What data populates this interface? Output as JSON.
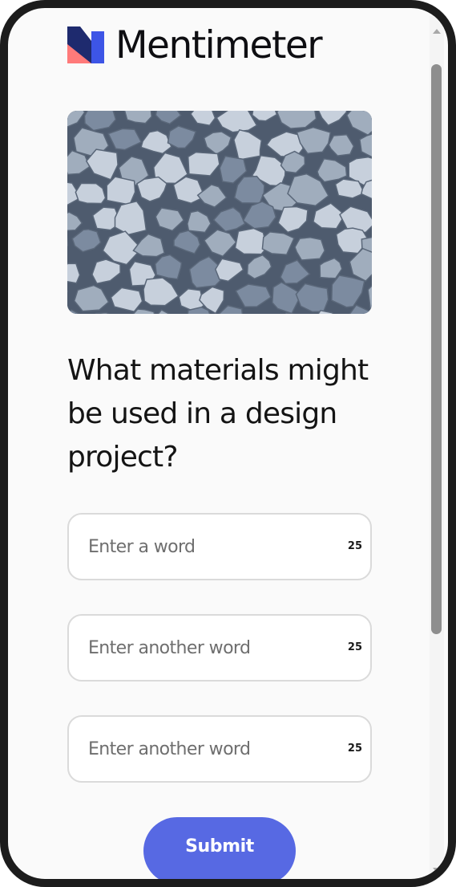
{
  "brand": {
    "name": "Mentimeter",
    "colors": {
      "navy": "#1e2a6e",
      "blue": "#3d55e6",
      "coral": "#ff7a7a"
    }
  },
  "hero_image": {
    "subject": "pile of grey gravel stones",
    "colors": {
      "base": "#4e5b6e",
      "stone_light": "#c7d0dc",
      "stone_mid": "#a0adbd",
      "stone_dark": "#7c8ba0"
    }
  },
  "question": {
    "text": "What materials might be used in a design project?"
  },
  "fields": [
    {
      "placeholder": "Enter a word",
      "limit": "25"
    },
    {
      "placeholder": "Enter another word",
      "limit": "25"
    },
    {
      "placeholder": "Enter another word",
      "limit": "25"
    }
  ],
  "submit": {
    "label": "Submit",
    "color": "#5769e3"
  }
}
